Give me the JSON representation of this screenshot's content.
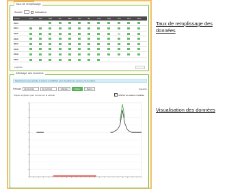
{
  "side_labels": {
    "fill_rate": "Taux de remplissage des données",
    "visualisation": "Visualisation des données"
  },
  "panel1": {
    "title": "Taux de remplissage",
    "controls_label": "Année",
    "controls_option": "Indicateur",
    "columns": [
      "Année",
      "Jan",
      "Fév",
      "Mar",
      "Avr",
      "Mai",
      "Jun",
      "Jul",
      "Aoû",
      "Sep",
      "Oct",
      "Nov",
      "Déc"
    ],
    "rows": [
      {
        "year": "2013",
        "cells": [
          "",
          "",
          "ok",
          "ok",
          "ok",
          "ok",
          "ok",
          "ok",
          "ok",
          "ok",
          "ok",
          "ok"
        ]
      },
      {
        "year": "2014",
        "cells": [
          "ok",
          "ok",
          "ok",
          "ok",
          "ok",
          "ok",
          "ok",
          "ok",
          "ok",
          "ok",
          "ok",
          "ok"
        ]
      },
      {
        "year": "2015",
        "cells": [
          "ok",
          "ok",
          "ok",
          "ok",
          "ok",
          "ok",
          "ok",
          "ok",
          "ok",
          "part",
          "ok",
          "ok"
        ]
      },
      {
        "year": "2016",
        "cells": [
          "ok",
          "ok",
          "ok",
          "ok",
          "ok",
          "ok",
          "ok",
          "ok",
          "ok",
          "ok",
          "ok",
          "ok"
        ]
      },
      {
        "year": "2017",
        "cells": [
          "ok",
          "ok",
          "ok",
          "ok",
          "ok",
          "ok",
          "ok",
          "ok",
          "ok",
          "ok",
          "ok",
          "ok"
        ]
      },
      {
        "year": "2018",
        "cells": [
          "ok",
          "ok",
          "ok",
          "ok",
          "ok",
          "ok",
          "ok",
          "ok",
          "ok",
          "ok",
          "ok",
          "ok"
        ]
      },
      {
        "year": "2019",
        "cells": [
          "ok",
          "ok",
          "ok",
          "ok",
          "ok",
          "ok",
          "ok",
          "ok",
          "ok",
          "ok",
          "ok",
          "ok"
        ]
      },
      {
        "year": "2020",
        "cells": [
          "ok",
          "ok",
          "ok",
          "ok",
          "ok",
          "ok",
          "ok",
          "ok",
          "",
          "",
          "",
          ""
        ]
      }
    ],
    "footer": "Légende"
  },
  "panel2": {
    "title": "Affichage des données",
    "info": "Sélectionnez une période et cliquez sur Afficher pour visualiser les mesures de la station.",
    "period_label": "Période",
    "date_from": "01/01/2019",
    "date_to": "31/12/2019",
    "btn_show": "Afficher",
    "btn_filter": "Filtrer",
    "btn_reset": "Réinit.",
    "export": "Exporter",
    "chart_note": "Cliquez et glissez pour zoomer sur la période",
    "checkbox_label": "Afficher les valeurs invalides",
    "checkbox_checked": true
  },
  "chart_data": {
    "type": "line",
    "title": "",
    "xlabel": "",
    "ylabel": "",
    "x": [
      0,
      1,
      2,
      3,
      4,
      5,
      6,
      7,
      8,
      9,
      10,
      11,
      12,
      13,
      14,
      15,
      16,
      17,
      18,
      19,
      20,
      21,
      22,
      23,
      24,
      25,
      26,
      27,
      28,
      29,
      30,
      31,
      32,
      33,
      34,
      35,
      36,
      37,
      38,
      39,
      40,
      41,
      42,
      43,
      44,
      45,
      46,
      47
    ],
    "series": [
      {
        "color": "#3a3a3a",
        "values": [
          null,
          null,
          null,
          3.0,
          3.0,
          3.0,
          3.0,
          null,
          null,
          null,
          null,
          null,
          null,
          null,
          null,
          null,
          null,
          null,
          null,
          null,
          null,
          null,
          null,
          null,
          null,
          null,
          null,
          null,
          null,
          null,
          null,
          null,
          null,
          null,
          3.0,
          3.0,
          3.1,
          3.2,
          3.5,
          4.5,
          3.6,
          3.2,
          3.05,
          3.0,
          3.0,
          3.0,
          3.0,
          3.0
        ]
      },
      {
        "color": "#e53935",
        "values": [
          null,
          null,
          null,
          null,
          null,
          null,
          null,
          null,
          null,
          null,
          0.05,
          0.05,
          0.05,
          0.05,
          0.05,
          0.05,
          0.05,
          0.05,
          0.05,
          0.05,
          0.05,
          0.05,
          0.05,
          0.05,
          0.05,
          0.05,
          0.05,
          0.05,
          0.05,
          null,
          null,
          null,
          null,
          null,
          null,
          null,
          null,
          null,
          null,
          null,
          null,
          null,
          null,
          null,
          null,
          null,
          null,
          null
        ]
      },
      {
        "color": "#43a047",
        "values": [
          null,
          null,
          null,
          null,
          null,
          null,
          null,
          null,
          null,
          null,
          null,
          null,
          null,
          null,
          null,
          null,
          null,
          null,
          null,
          null,
          null,
          null,
          null,
          null,
          null,
          null,
          null,
          null,
          null,
          null,
          null,
          null,
          null,
          null,
          null,
          null,
          null,
          null,
          3.8,
          4.9,
          4.0,
          null,
          null,
          null,
          null,
          null,
          null,
          null
        ]
      }
    ],
    "ylim": [
      0,
      5
    ],
    "grid": true
  },
  "colors": {
    "frame": "#f0c069",
    "panel_border": "#7cb342",
    "ok": "#66bb6a",
    "partial": "#cfcfcf",
    "header": "#4a4a4a"
  }
}
